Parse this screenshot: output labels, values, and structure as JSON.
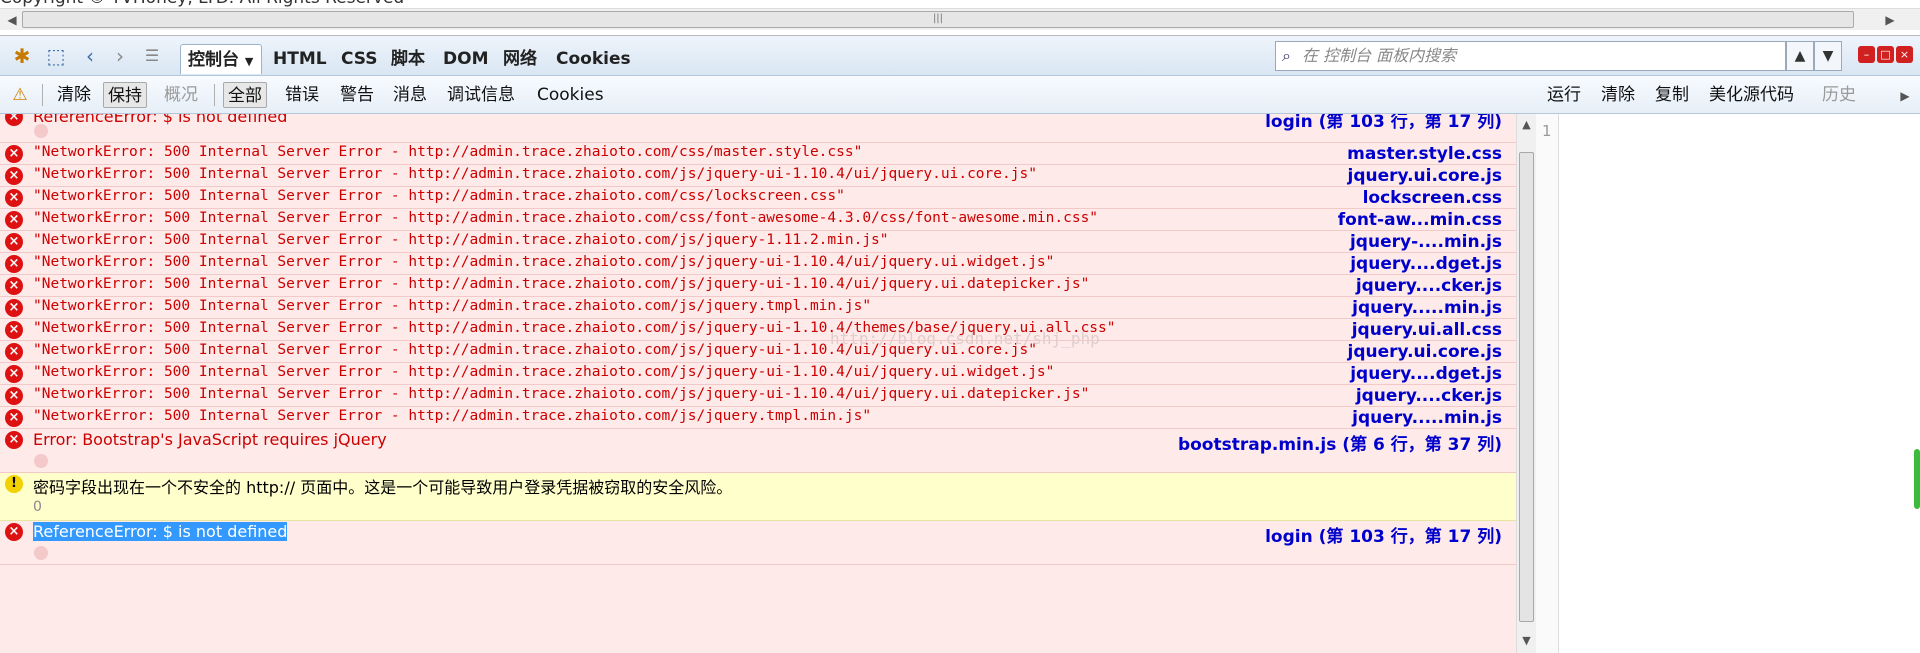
{
  "page": {
    "copyright": "Copyright © TVHoney, LTD. All Rights Reserved"
  },
  "tabbar": {
    "tabs": [
      {
        "label": "控制台",
        "active": true
      },
      {
        "label": "HTML"
      },
      {
        "label": "CSS"
      },
      {
        "label": "脚本"
      },
      {
        "label": "DOM"
      },
      {
        "label": "网络"
      },
      {
        "label": "Cookies"
      }
    ],
    "search_placeholder": "在 控制台 面板内搜索"
  },
  "toolbar": {
    "left": [
      {
        "label": "清除"
      },
      {
        "label": "保持",
        "pressed": true
      },
      {
        "label": "概况",
        "disabled": true
      }
    ],
    "filters": [
      {
        "label": "全部",
        "pressed": true
      },
      {
        "label": "错误"
      },
      {
        "label": "警告"
      },
      {
        "label": "消息"
      },
      {
        "label": "调试信息"
      },
      {
        "label": "Cookies"
      }
    ],
    "right": [
      {
        "label": "运行"
      },
      {
        "label": "清除"
      },
      {
        "label": "复制"
      },
      {
        "label": "美化源代码"
      },
      {
        "label": "历史",
        "disabled": true
      }
    ]
  },
  "log": {
    "watermark": "http://blog.csdn.net/shj_php",
    "entries": [
      {
        "type": "error",
        "message": "ReferenceError: $ is not defined",
        "source": "login (第 103 行，第 17 列)"
      },
      {
        "type": "network",
        "message": "\"NetworkError: 500 Internal Server Error - http://admin.trace.zhaioto.com/css/master.style.css\"",
        "source": "master.style.css"
      },
      {
        "type": "network",
        "message": "\"NetworkError: 500 Internal Server Error - http://admin.trace.zhaioto.com/js/jquery-ui-1.10.4/ui/jquery.ui.core.js\"",
        "source": "jquery.ui.core.js"
      },
      {
        "type": "network",
        "message": "\"NetworkError: 500 Internal Server Error - http://admin.trace.zhaioto.com/css/lockscreen.css\"",
        "source": "lockscreen.css"
      },
      {
        "type": "network",
        "message": "\"NetworkError: 500 Internal Server Error - http://admin.trace.zhaioto.com/css/font-awesome-4.3.0/css/font-awesome.min.css\"",
        "source": "font-aw...min.css"
      },
      {
        "type": "network",
        "message": "\"NetworkError: 500 Internal Server Error - http://admin.trace.zhaioto.com/js/jquery-1.11.2.min.js\"",
        "source": "jquery-....min.js"
      },
      {
        "type": "network",
        "message": "\"NetworkError: 500 Internal Server Error - http://admin.trace.zhaioto.com/js/jquery-ui-1.10.4/ui/jquery.ui.widget.js\"",
        "source": "jquery....dget.js"
      },
      {
        "type": "network",
        "message": "\"NetworkError: 500 Internal Server Error - http://admin.trace.zhaioto.com/js/jquery-ui-1.10.4/ui/jquery.ui.datepicker.js\"",
        "source": "jquery....cker.js"
      },
      {
        "type": "network",
        "message": "\"NetworkError: 500 Internal Server Error - http://admin.trace.zhaioto.com/js/jquery.tmpl.min.js\"",
        "source": "jquery.....min.js"
      },
      {
        "type": "network",
        "message": "\"NetworkError: 500 Internal Server Error - http://admin.trace.zhaioto.com/js/jquery-ui-1.10.4/themes/base/jquery.ui.all.css\"",
        "source": "jquery.ui.all.css"
      },
      {
        "type": "network",
        "message": "\"NetworkError: 500 Internal Server Error - http://admin.trace.zhaioto.com/js/jquery-ui-1.10.4/ui/jquery.ui.core.js\"",
        "source": "jquery.ui.core.js"
      },
      {
        "type": "network",
        "message": "\"NetworkError: 500 Internal Server Error - http://admin.trace.zhaioto.com/js/jquery-ui-1.10.4/ui/jquery.ui.widget.js\"",
        "source": "jquery....dget.js"
      },
      {
        "type": "network",
        "message": "\"NetworkError: 500 Internal Server Error - http://admin.trace.zhaioto.com/js/jquery-ui-1.10.4/ui/jquery.ui.datepicker.js\"",
        "source": "jquery....cker.js"
      },
      {
        "type": "network",
        "message": "\"NetworkError: 500 Internal Server Error - http://admin.trace.zhaioto.com/js/jquery.tmpl.min.js\"",
        "source": "jquery.....min.js"
      },
      {
        "type": "error",
        "message": "Error: Bootstrap's JavaScript requires jQuery",
        "source": "bootstrap.min.js (第 6 行，第 37 列)"
      },
      {
        "type": "warning",
        "message": "密码字段出现在一个不安全的 http:// 页面中。这是一个可能导致用户登录凭据被窃取的安全风险。",
        "sub": "0"
      },
      {
        "type": "error",
        "message": "ReferenceError: $ is not defined",
        "source": "login (第 103 行，第 17 列)",
        "selected": true
      }
    ]
  },
  "editor": {
    "line_number": "1"
  },
  "colors": {
    "error_bg": "#ffeaea",
    "warning_bg": "#ffffcc",
    "error_text": "#cc0000",
    "source_link": "#0000cc",
    "selection": "#3399ff"
  }
}
